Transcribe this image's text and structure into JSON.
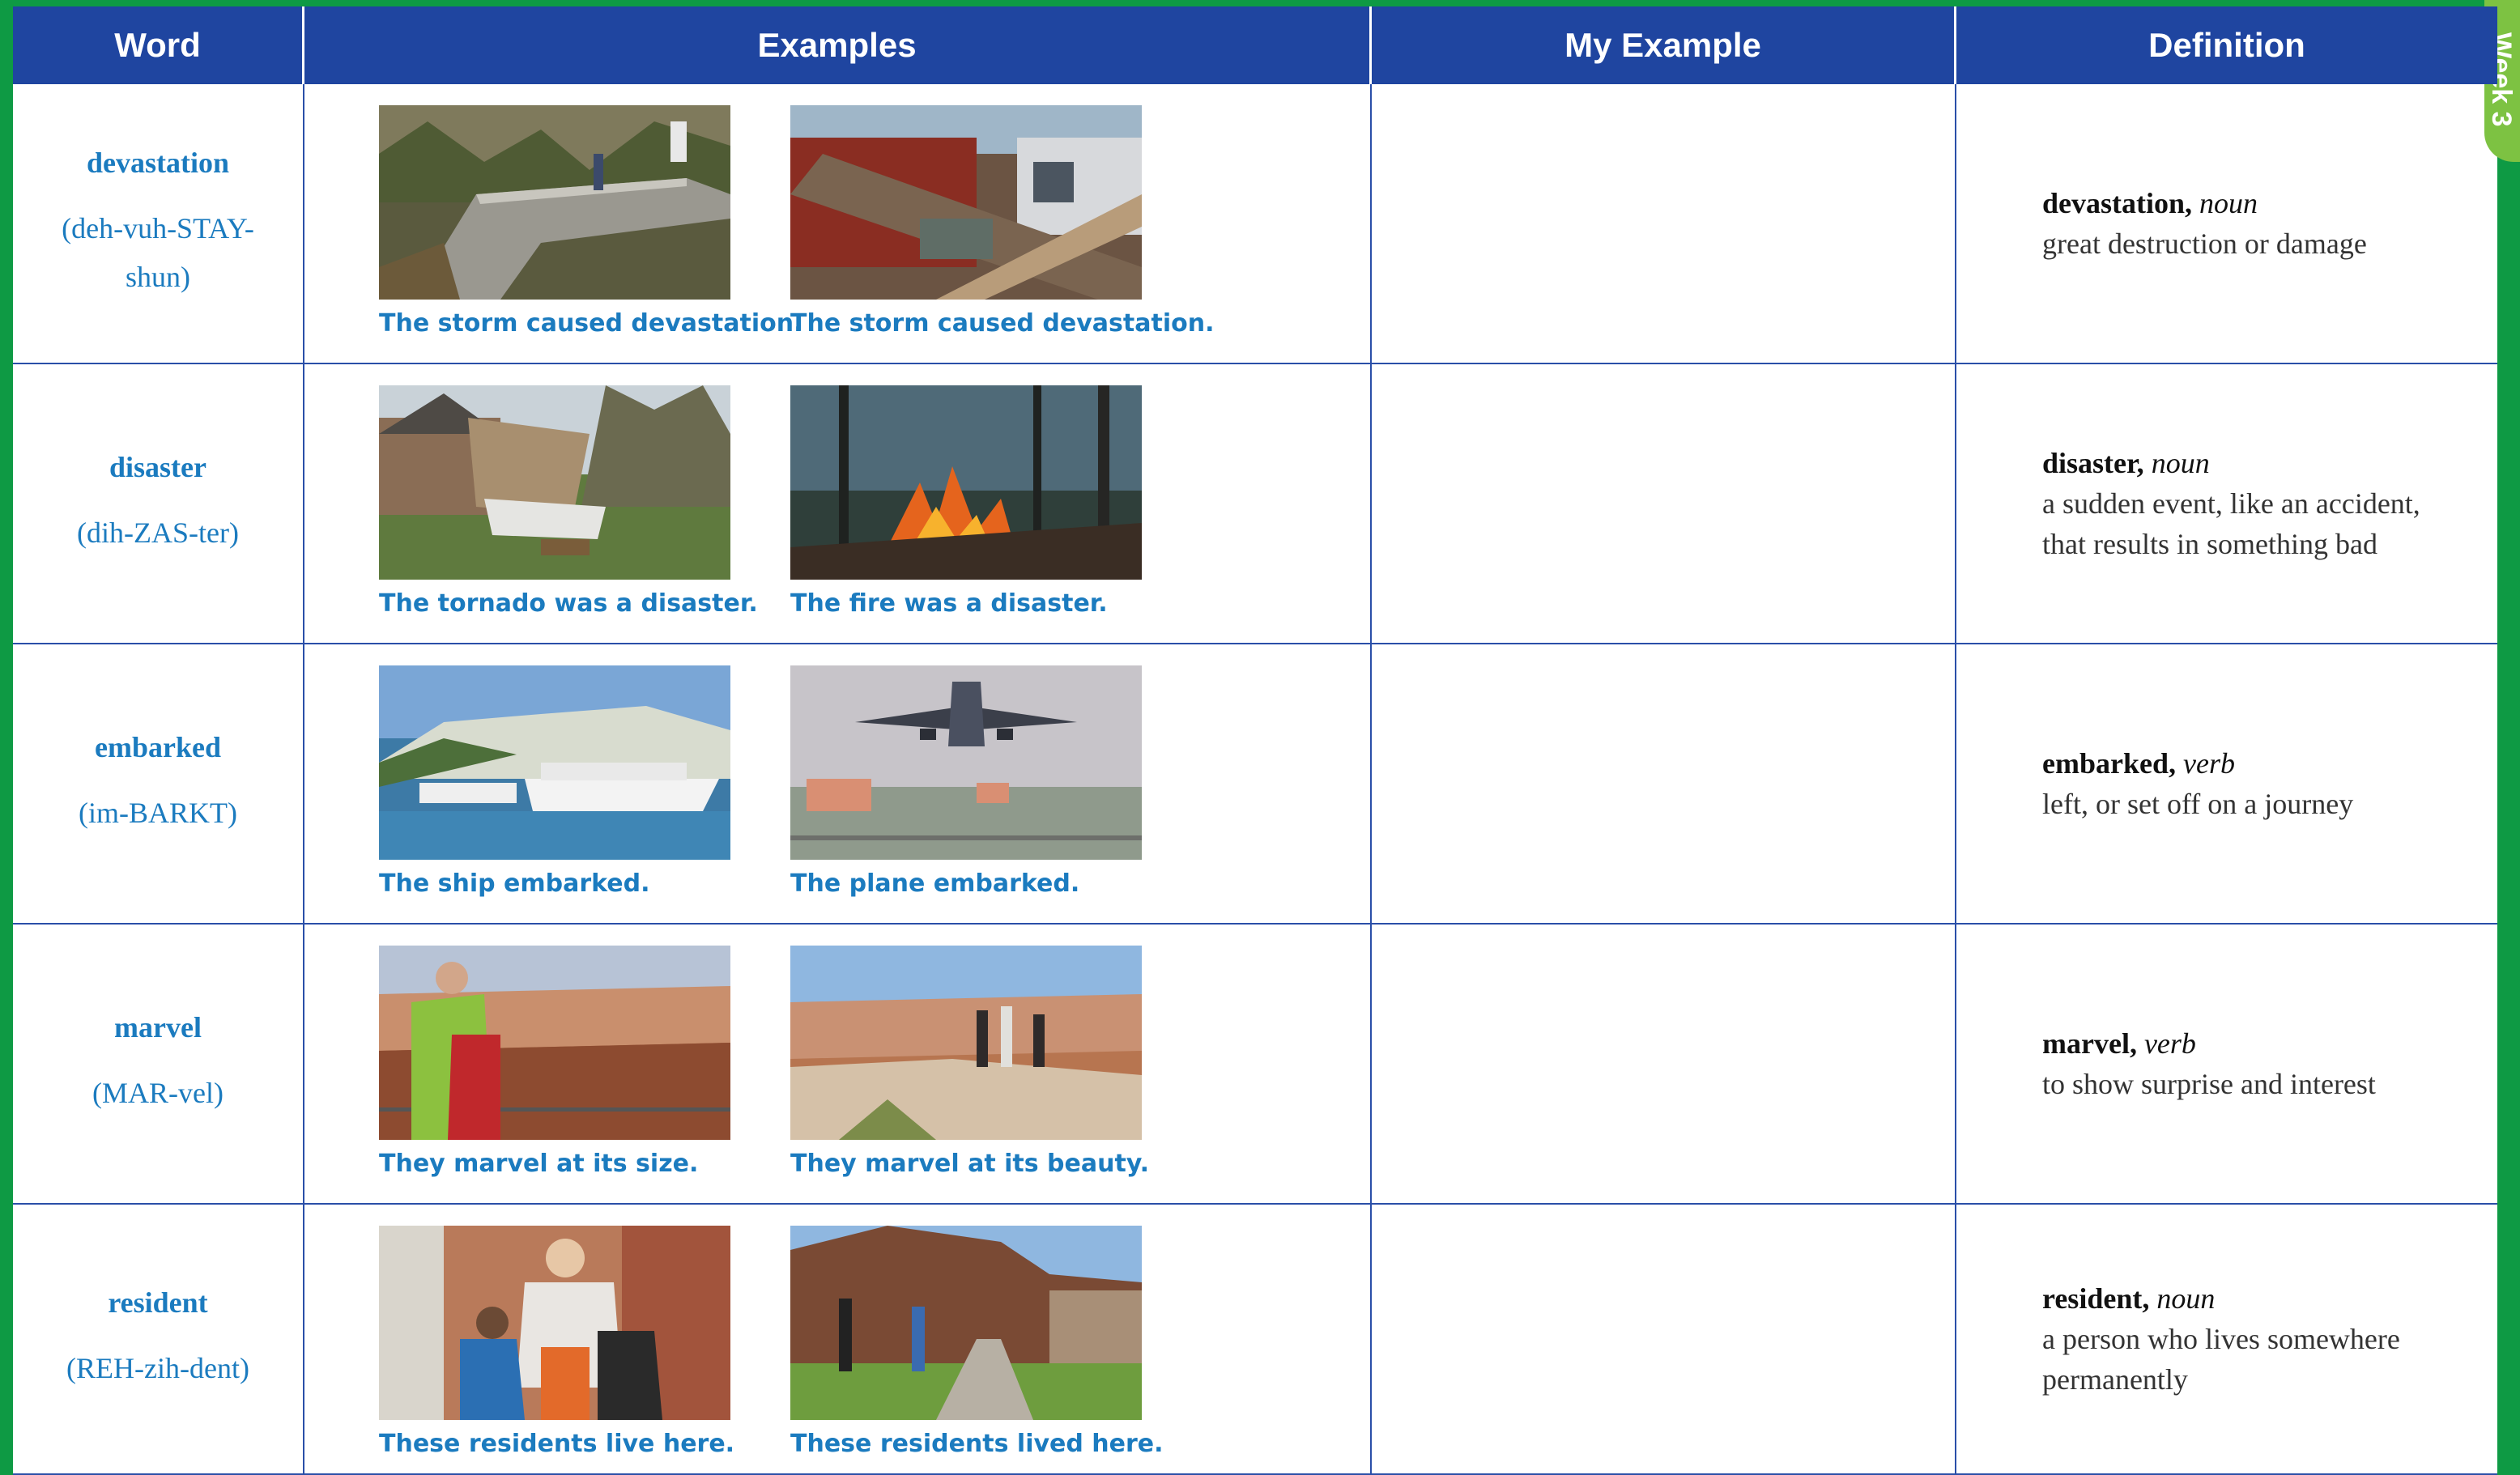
{
  "side_tab": {
    "text": "Week 3"
  },
  "headers": [
    "Word",
    "Examples",
    "My Example",
    "Definition"
  ],
  "rows": [
    {
      "word": "devastation",
      "pronunciation": "(deh-vuh-STAY-shun)",
      "captions": [
        "The storm caused devastation.",
        "The storm caused devastation."
      ],
      "def_word": "devastation,",
      "def_pos": "noun",
      "def_text": "great destruction or damage"
    },
    {
      "word": "disaster",
      "pronunciation": "(dih-ZAS-ter)",
      "captions": [
        "The tornado was a disaster.",
        "The fire was a disaster."
      ],
      "def_word": "disaster,",
      "def_pos": "noun",
      "def_text": "a sudden event, like an accident, that results in something bad"
    },
    {
      "word": "embarked",
      "pronunciation": "(im-BARKT)",
      "captions": [
        "The ship embarked.",
        "The plane embarked."
      ],
      "def_word": "embarked,",
      "def_pos": "verb",
      "def_text": "left, or set off on a journey"
    },
    {
      "word": "marvel",
      "pronunciation": "(MAR-vel)",
      "captions": [
        "They marvel at its size.",
        "They marvel at its beauty."
      ],
      "def_word": "marvel,",
      "def_pos": "verb",
      "def_text": "to show surprise and interest"
    },
    {
      "word": "resident",
      "pronunciation": "(REH-zih-dent)",
      "captions": [
        "These residents live here.",
        "These residents lived here."
      ],
      "def_word": "resident,",
      "def_pos": "noun",
      "def_text": "a person who lives somewhere permanently"
    }
  ],
  "colors": {
    "header_bg": "#1f45a0",
    "frame": "#0e9a44",
    "accent_text": "#1b7bbf",
    "tab": "#7dc242"
  }
}
